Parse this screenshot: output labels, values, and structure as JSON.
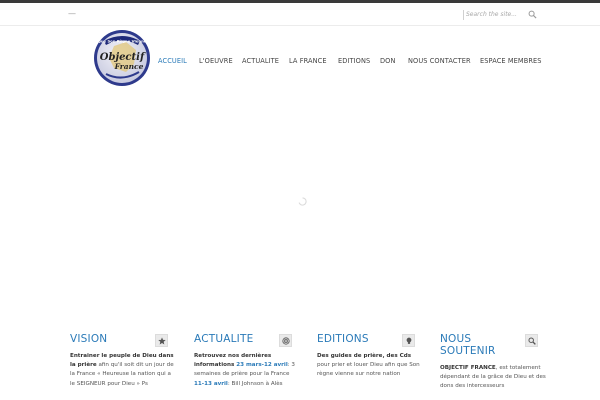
{
  "topbar": {
    "left_text": "—",
    "search_placeholder": "Search the site..."
  },
  "logo": {
    "top_banner": "Que Son Règne Vienne",
    "line1": "Objectif",
    "line2": "France"
  },
  "nav": {
    "items": [
      "ACCUEIL",
      "L'OEUVRE",
      "ACTUALITE",
      "LA FRANCE",
      "EDITIONS",
      "DON",
      "NOUS CONTACTER",
      "ESPACE MEMBRES"
    ]
  },
  "columns": {
    "vision": {
      "title": "VISION",
      "icon": "star-icon",
      "p1": "Entrainer le peuple de Dieu dans la prière",
      "p2": " afin qu'il soit dit un jour de la France « Heureuse la nation qui a le SEIGNEUR pour Dieu » Ps"
    },
    "actualite": {
      "title": "ACTUALITE",
      "icon": "target-icon",
      "p1": "Retrouvez nos dernières informations",
      "h1": " 23 mars-12 avril",
      "p2": ": 3 semaines de prière pour la France ",
      "h2": " 11-13 avril",
      "p3": ": Bill Johnson à Alès"
    },
    "editions": {
      "title": "EDITIONS",
      "icon": "lightbulb-icon",
      "p1": "Des guides de prière, des Cds",
      "p2": " pour prier et louer Dieu afin que Son règne vienne sur notre nation"
    },
    "soutenir": {
      "title": "NOUS SOUTENIR",
      "icon": "magnifier-icon",
      "p1": "OBJECTIF FRANCE",
      "p2": ", est totalement dépendant de la grâce de Dieu et des dons des intercesseurs"
    }
  },
  "colors": {
    "accent": "#2a7ab8",
    "topstrip": "#3a3a3a",
    "text": "#555555"
  }
}
